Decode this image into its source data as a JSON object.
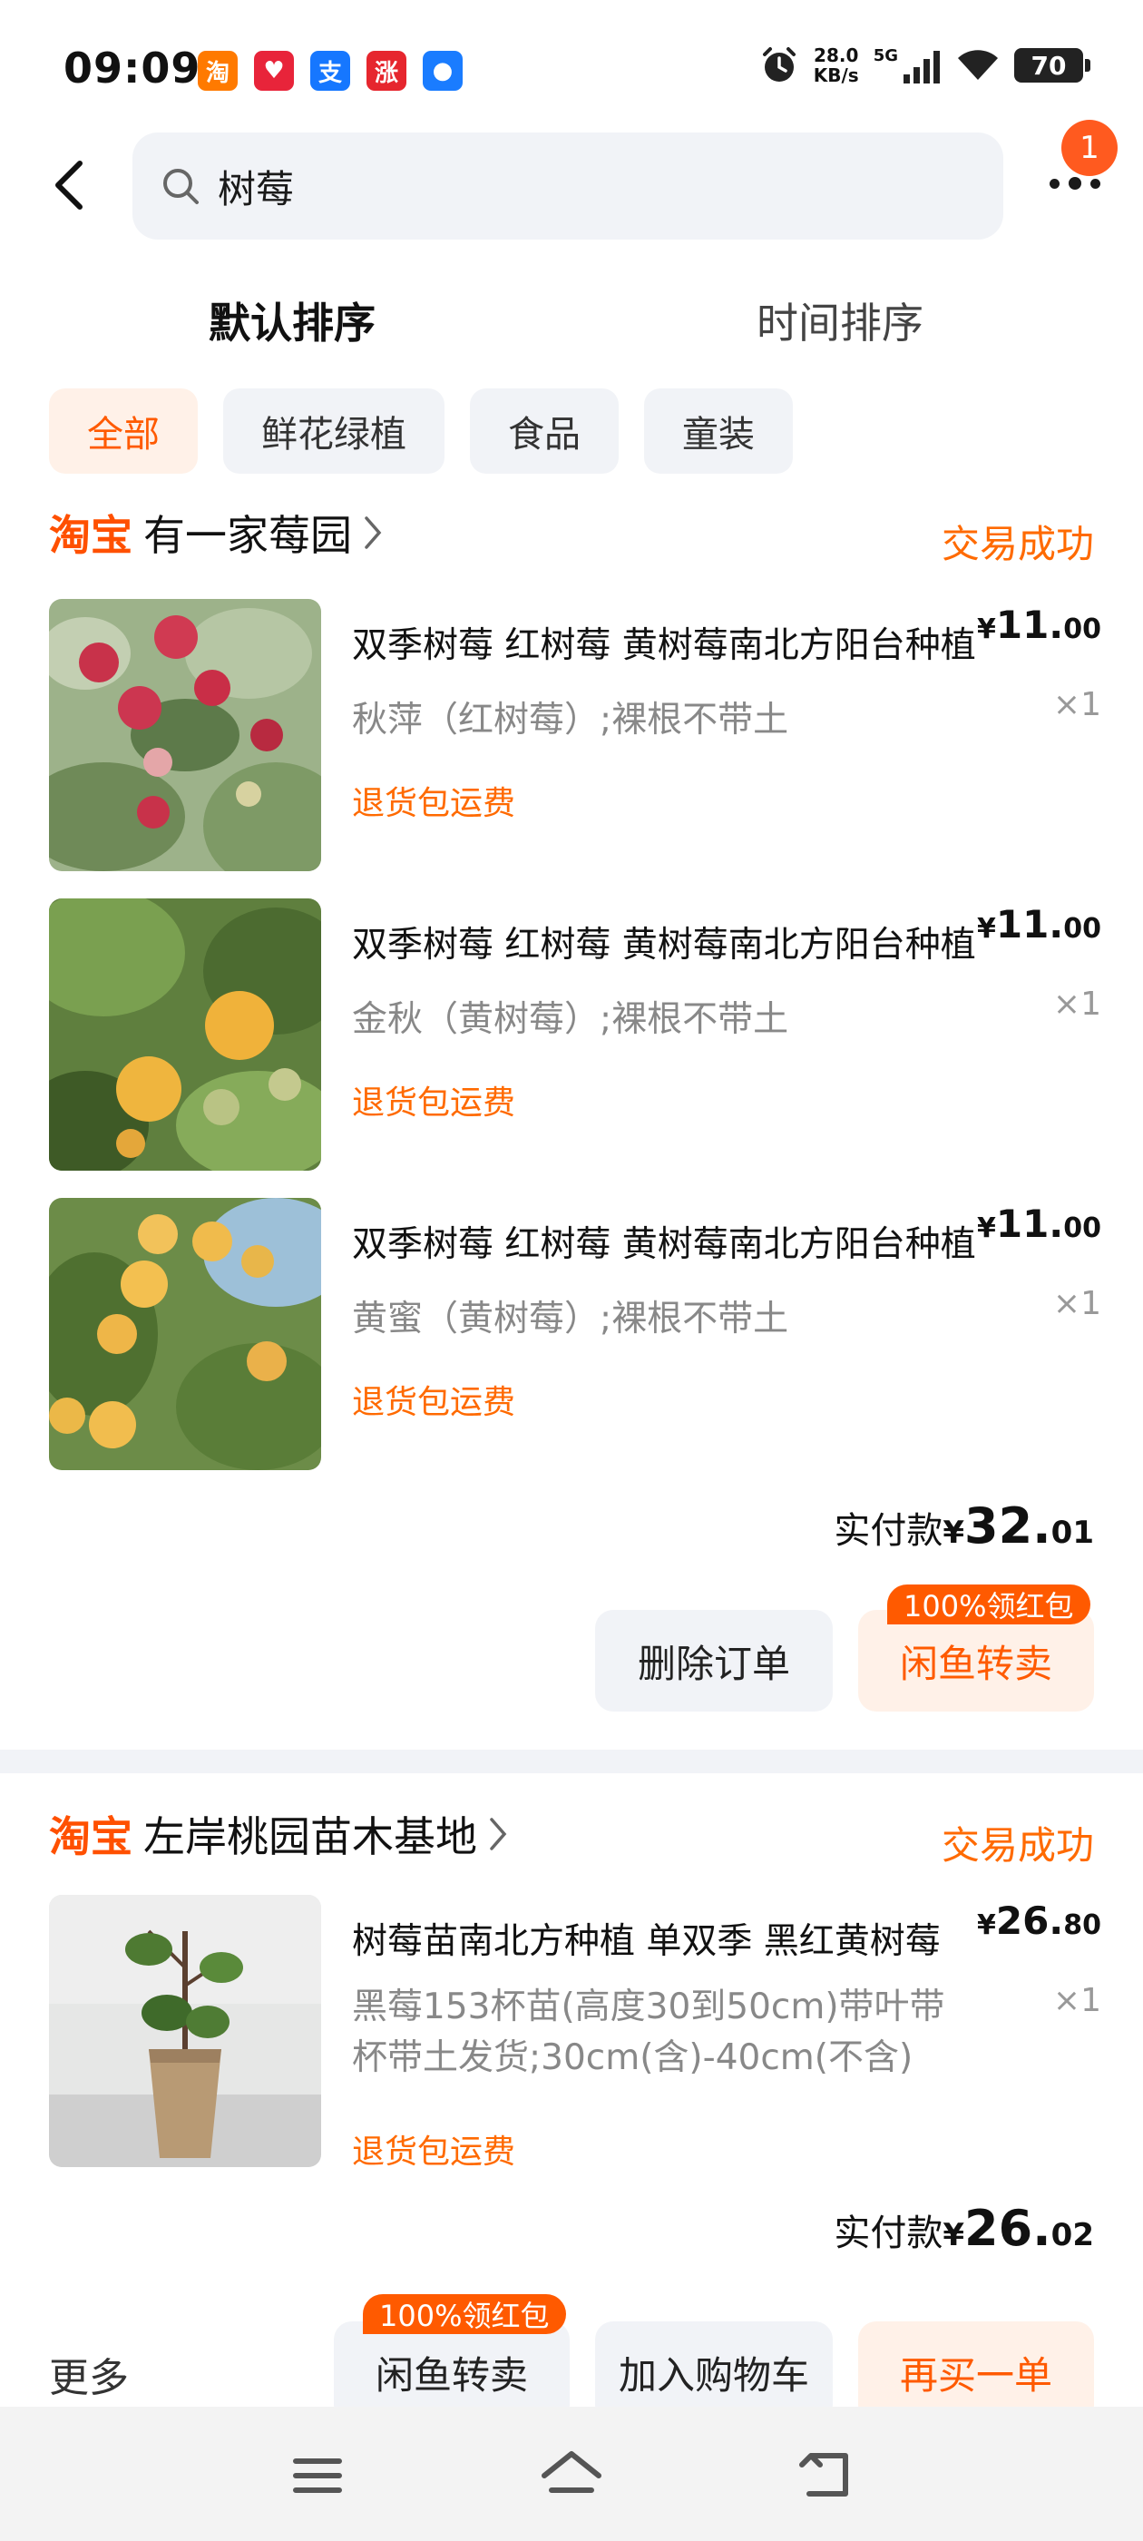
{
  "status_bar": {
    "time": "09:09",
    "app_icons": [
      {
        "name": "taobao-app-icon",
        "glyph": "淘",
        "color": "#ff7a00"
      },
      {
        "name": "heart-app-icon",
        "glyph": "♥",
        "color": "#e8243a"
      },
      {
        "name": "alipay-app-icon",
        "glyph": "支",
        "color": "#1677ff"
      },
      {
        "name": "rise-app-icon",
        "glyph": "涨",
        "color": "#e6262e"
      },
      {
        "name": "assistant-app-icon",
        "glyph": "●",
        "color": "#1a7cff"
      }
    ],
    "net_speed": "28.0",
    "net_unit": "KB/s",
    "network": "5G",
    "battery": "70"
  },
  "search": {
    "query": "树莓",
    "notification_count": "1"
  },
  "sort_tabs": [
    {
      "label": "默认排序",
      "active": true
    },
    {
      "label": "时间排序",
      "active": false
    }
  ],
  "categories": [
    {
      "label": "全部",
      "active": true
    },
    {
      "label": "鲜花绿植",
      "active": false
    },
    {
      "label": "食品",
      "active": false
    },
    {
      "label": "童装",
      "active": false
    }
  ],
  "orders": [
    {
      "platform": "淘宝",
      "shop": "有一家莓园",
      "status": "交易成功",
      "items": [
        {
          "title": "双季树莓 红树莓 黄树莓南北方阳台种植",
          "spec": "秋萍（红树莓）;裸根不带土",
          "tag": "退货包运费",
          "price_currency": "¥",
          "price_int": "11.",
          "price_dec": "00",
          "qty": "×1"
        },
        {
          "title": "双季树莓 红树莓 黄树莓南北方阳台种植",
          "spec": "金秋（黄树莓）;裸根不带土",
          "tag": "退货包运费",
          "price_currency": "¥",
          "price_int": "11.",
          "price_dec": "00",
          "qty": "×1"
        },
        {
          "title": "双季树莓 红树莓 黄树莓南北方阳台种植",
          "spec": "黄蜜（黄树莓）;裸根不带土",
          "tag": "退货包运费",
          "price_currency": "¥",
          "price_int": "11.",
          "price_dec": "00",
          "qty": "×1"
        }
      ],
      "paid_label": "实付款",
      "paid_currency": "¥",
      "paid_int": "32.",
      "paid_dec": "01",
      "actions": {
        "delete": "删除订单",
        "resell": "闲鱼转卖",
        "promo": "100%领红包"
      }
    },
    {
      "platform": "淘宝",
      "shop": "左岸桃园苗木基地",
      "status": "交易成功",
      "items": [
        {
          "title": "树莓苗南北方种植 单双季 黑红黄树莓",
          "spec": "黑莓153杯苗(高度30到50cm)带叶带杯带土发货;30cm(含)-40cm(不含)",
          "tag": "退货包运费",
          "price_currency": "¥",
          "price_int": "26.",
          "price_dec": "80",
          "qty": "×1"
        }
      ],
      "paid_label": "实付款",
      "paid_currency": "¥",
      "paid_int": "26.",
      "paid_dec": "02",
      "actions": {
        "more": "更多",
        "resell": "闲鱼转卖",
        "promo": "100%领红包",
        "add_cart": "加入购物车",
        "rebuy": "再买一单"
      }
    }
  ],
  "colors": {
    "accent": "#ff5a00",
    "status_orange": "#ff6a00",
    "chip_bg": "#f1f3f7",
    "chip_active_bg": "#fff1e8"
  }
}
